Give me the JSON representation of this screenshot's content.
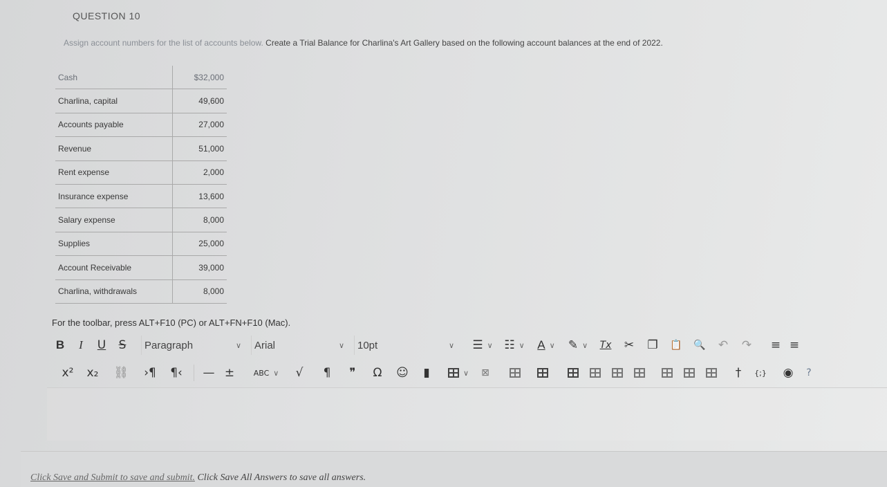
{
  "question": {
    "title": "QUESTION 10",
    "instructions_faded": "Assign account numbers for the list of accounts below.",
    "instructions": "Create a Trial Balance for Charlina's Art Gallery based on the following account balances at the end of 2022."
  },
  "accounts": [
    {
      "name": "Cash",
      "amount": "$32,000"
    },
    {
      "name": "Charlina, capital",
      "amount": "49,600"
    },
    {
      "name": "Accounts payable",
      "amount": "27,000"
    },
    {
      "name": "Revenue",
      "amount": "51,000"
    },
    {
      "name": "Rent expense",
      "amount": "2,000"
    },
    {
      "name": "Insurance expense",
      "amount": "13,600"
    },
    {
      "name": "Salary expense",
      "amount": "8,000"
    },
    {
      "name": "Supplies",
      "amount": "25,000"
    },
    {
      "name": "Account Receivable",
      "amount": "39,000"
    },
    {
      "name": "Charlina, withdrawals",
      "amount": "8,000"
    }
  ],
  "editor": {
    "toolbar_hint": "For the toolbar, press ALT+F10 (PC) or ALT+FN+F10 (Mac).",
    "bold": "B",
    "italic": "I",
    "underline": "U",
    "strikethrough": "S",
    "block_format": "Paragraph",
    "font_family": "Arial",
    "font_size": "10pt",
    "superscript": "x²",
    "subscript": "x₂",
    "ltr": "›¶",
    "rtl": "¶‹",
    "hr": "—",
    "plusminus": "±",
    "spellcheck": "ABC",
    "sqrt": "√",
    "pilcrow": "¶",
    "quote": "❞",
    "omega": "Ω",
    "emoji": "☺",
    "bookmark": "▮",
    "table_x": "⊠",
    "clear_format": "Tx",
    "cut": "✂",
    "copy": "❐",
    "paste": "📋",
    "find": "🔍",
    "undo": "↶",
    "redo": "↷",
    "accessibility": "†",
    "source": "{;}",
    "preview": "◉",
    "help": "?"
  },
  "footer": {
    "prefix": "Click Save and Submit to save and submit.",
    "suffix": "Click Save All Answers to save all answers."
  },
  "colors": {
    "background": "#dfe0e1",
    "table_border": "#a9a9a9"
  }
}
